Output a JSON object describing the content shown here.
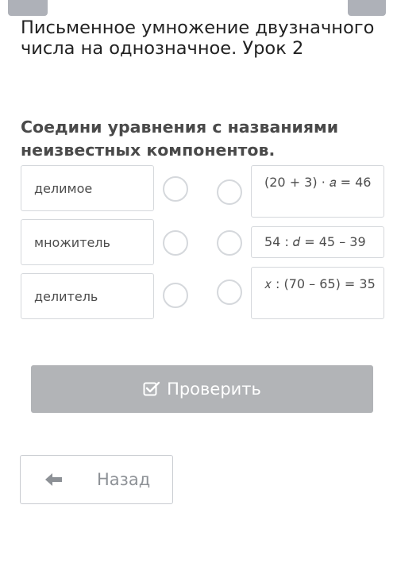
{
  "header": {
    "lesson_title": "Письменное умножение двузначного числа на однозначное. Урок 2"
  },
  "task": {
    "title": "Соедини уравнения с названиями неизвестных компонентов."
  },
  "left_items": [
    {
      "label": "делимое"
    },
    {
      "label": "множитель"
    },
    {
      "label": "делитель"
    }
  ],
  "right_items": [
    {
      "label": "(20 + 3) · 𝑎 = 46"
    },
    {
      "label": "54 : 𝑑 = 45 – 39"
    },
    {
      "label": "𝑥 : (70 – 65) = 35"
    }
  ],
  "buttons": {
    "check_label": "Проверить",
    "back_label": "Назад"
  },
  "icons": {
    "check": "check-square-icon",
    "back": "arrow-left-icon"
  },
  "colors": {
    "check_button_bg": "#b2b4b7",
    "border": "#d5d8dc"
  }
}
